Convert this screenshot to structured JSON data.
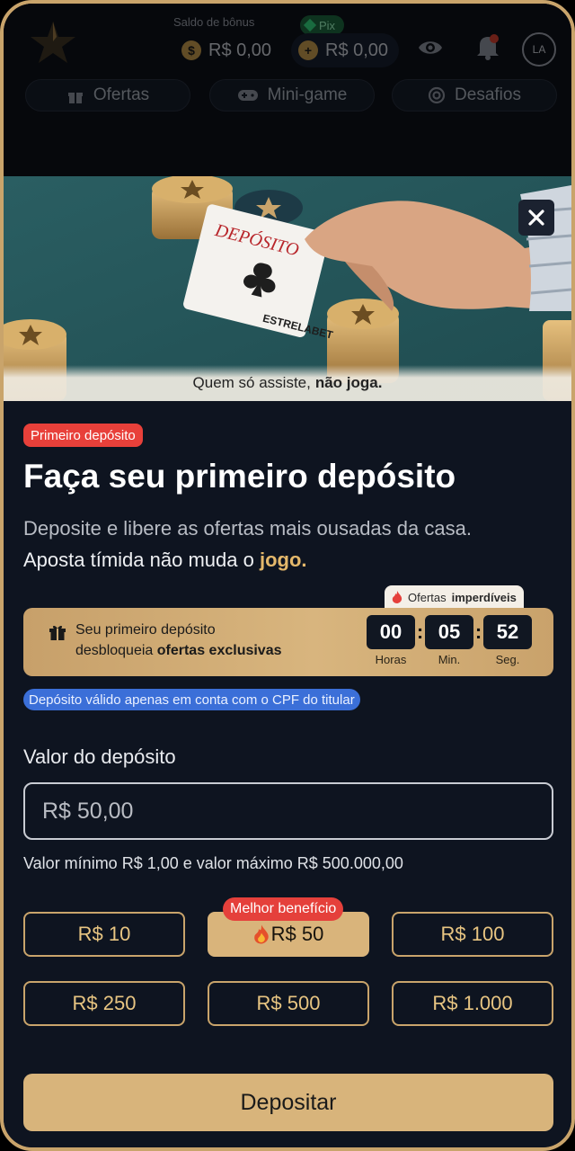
{
  "header": {
    "bonus_label": "Saldo de bônus",
    "bonus_balance": "R$ 0,00",
    "pix_tag": "Pix",
    "pix_balance": "R$ 0,00",
    "avatar_initials": "LA",
    "tabs": [
      {
        "label": "Ofertas",
        "icon": "gift-icon"
      },
      {
        "label": "Mini-game",
        "icon": "gamepad-icon"
      },
      {
        "label": "Desafios",
        "icon": "target-icon"
      }
    ]
  },
  "banner": {
    "caption_regular": "Quem só assiste,",
    "caption_bold": "não joga.",
    "card_word": "DEPÓSITO",
    "card_brand": "ESTRELABET"
  },
  "modal": {
    "badge": "Primeiro depósito",
    "title": "Faça seu primeiro depósito",
    "subtitle_line1": "Deposite e libere as ofertas mais ousadas da casa.",
    "subtitle_line2": "Aposta tímida não muda o",
    "subtitle_highlight": "jogo.",
    "offer": {
      "tag_regular": "Ofertas",
      "tag_bold": "imperdíveis",
      "text_line1": "Seu primeiro depósito",
      "text_line2": "desbloqueia",
      "text_bold": "ofertas exclusivas",
      "timer": [
        {
          "value": "00",
          "unit": "Horas"
        },
        {
          "value": "05",
          "unit": "Min."
        },
        {
          "value": "52",
          "unit": "Seg."
        }
      ],
      "separator": ":"
    },
    "cpf_note": "Depósito válido apenas em conta com o CPF do titular",
    "amount_label": "Valor do depósito",
    "amount_placeholder": "R$ 50,00",
    "limits": "Valor mínimo R$ 1,00 e valor máximo R$ 500.000,00",
    "best_tag": "Melhor benefício",
    "quick_amounts": [
      "R$ 10",
      "R$ 50",
      "R$ 100",
      "R$ 250",
      "R$ 500",
      "R$ 1.000"
    ],
    "selected_amount": "R$ 50",
    "deposit_button": "Depositar"
  },
  "colors": {
    "accent_gold": "#d8b47b",
    "badge_red": "#e8403a",
    "note_blue": "#3b6fd8",
    "background": "#0e1420"
  }
}
